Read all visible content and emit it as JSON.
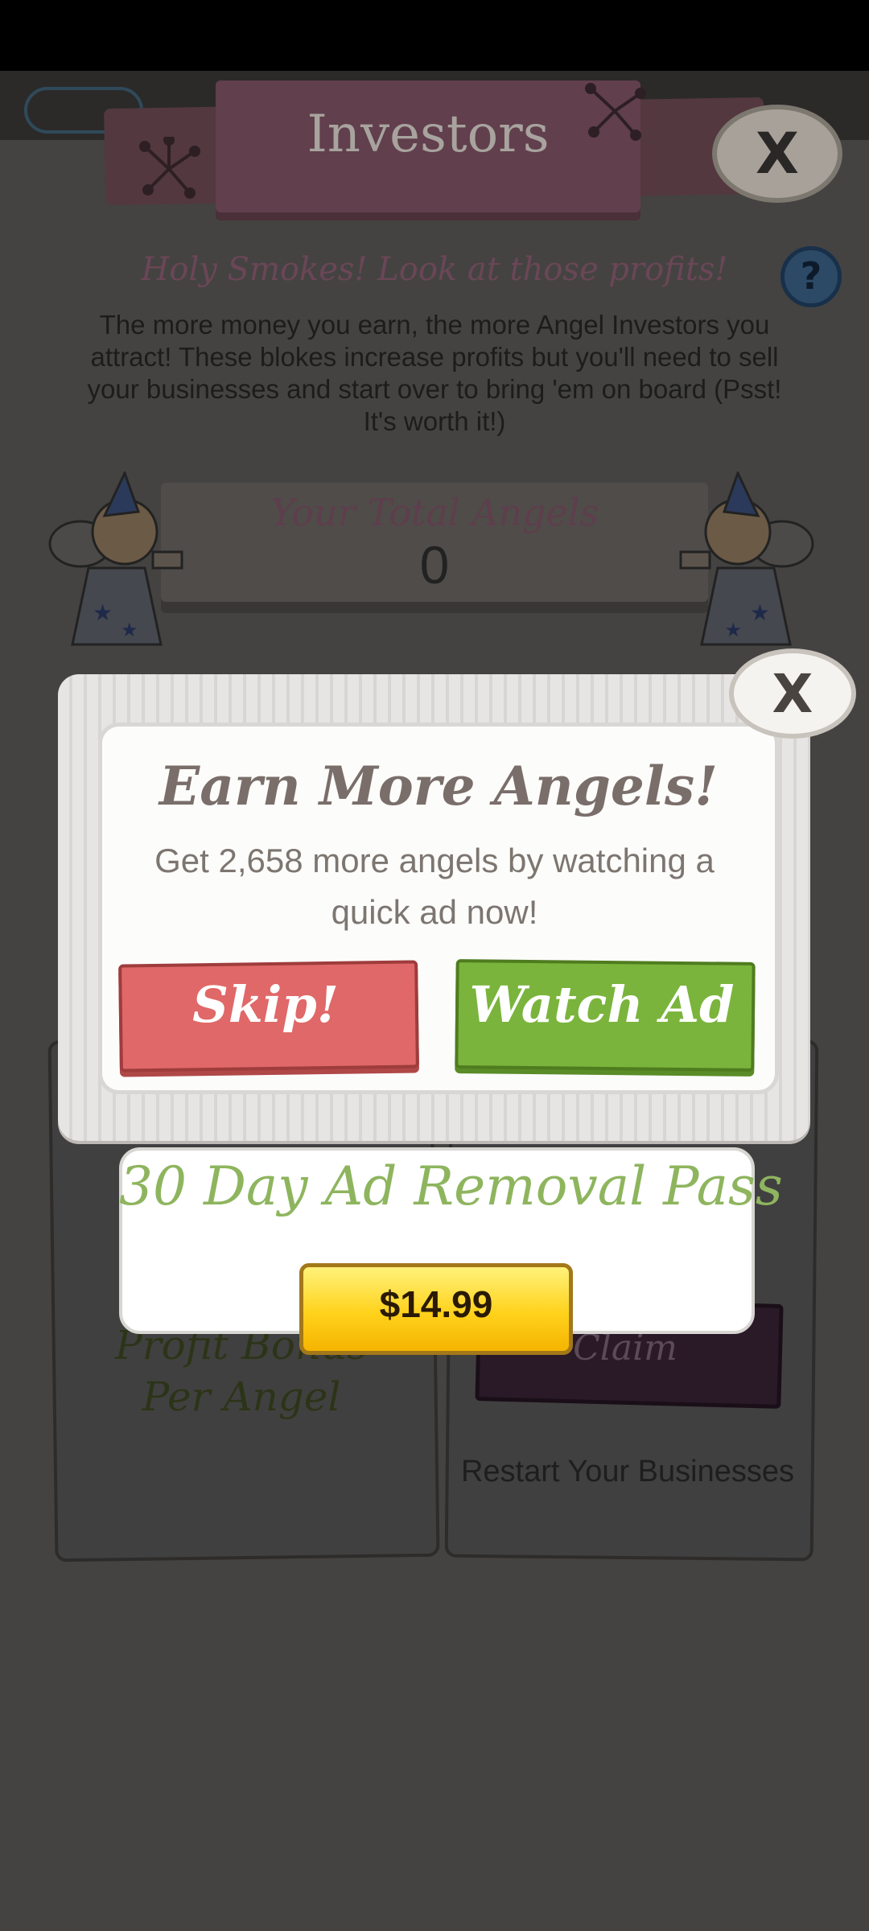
{
  "investors": {
    "title": "Investors",
    "heading": "Holy Smokes! Look at those profits!",
    "help_label": "?",
    "description": "The more money you earn, the more Angel Investors you attract! These blokes increase profits but you'll need to sell your businesses and start over to bring 'em on board (Psst! It's worth it!)",
    "total_angels_label": "Your Total Angels",
    "total_angels_value": "0",
    "close_label": "X"
  },
  "cards": {
    "left_text": "Profit Bonus Per Angel",
    "claim_label": "Claim",
    "restart_label": "Restart Your Businesses"
  },
  "popup": {
    "title": "Earn More Angels!",
    "body": "Get 2,658 more angels by watching a quick ad now!",
    "skip_label": "Skip!",
    "watch_label": "Watch Ad",
    "close_label": "X"
  },
  "offer": {
    "title": "30 Day Ad Removal Pass",
    "price": "$14.99"
  }
}
